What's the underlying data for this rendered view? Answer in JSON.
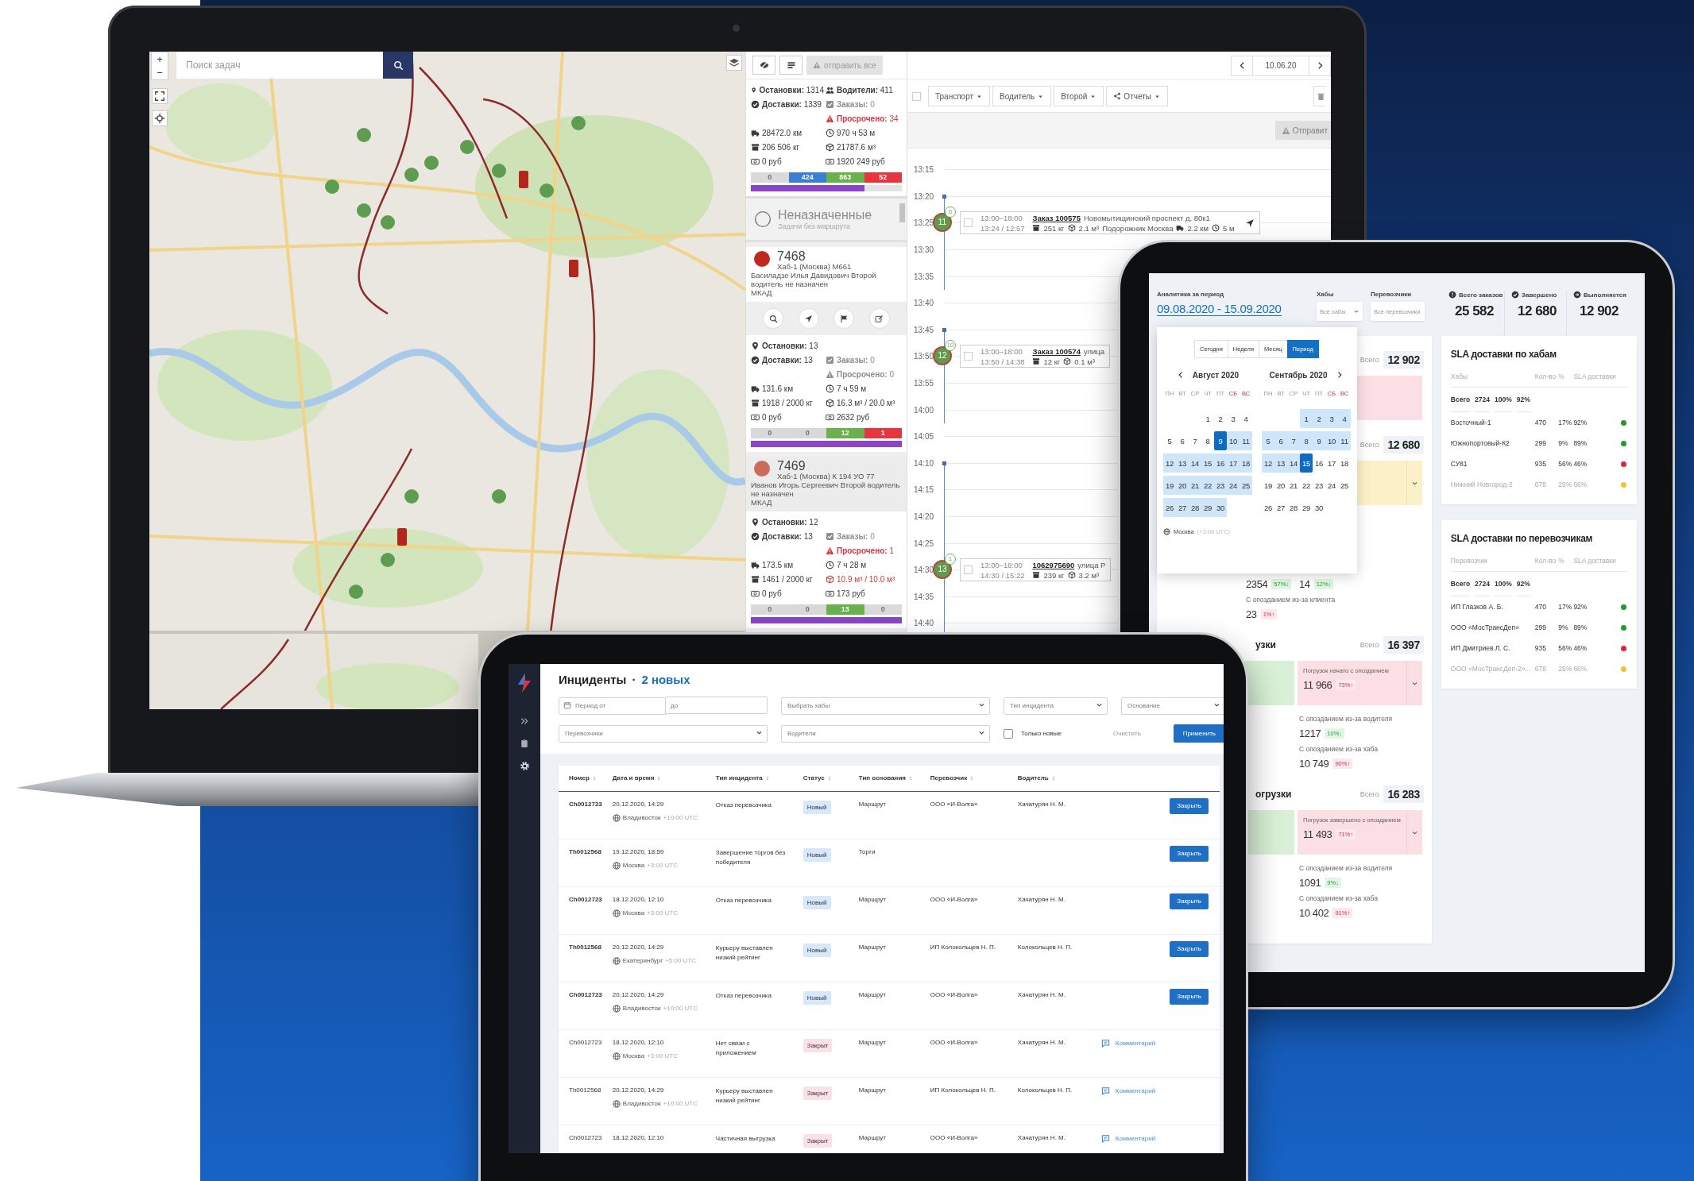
{
  "laptop": {
    "map": {
      "zoom_in": "+",
      "zoom_out": "−",
      "search": {
        "placeholder": "Поиск задач"
      }
    },
    "panel": {
      "send_all": {
        "label": "отправить все",
        "disabled": true
      },
      "summary": {
        "rows": [
          {
            "left": {
              "label": "Остановки:",
              "value": "1314"
            },
            "right": {
              "label": "Водители:",
              "value": "411"
            }
          },
          {
            "left": {
              "label": "Доставки:",
              "value": "1339"
            },
            "right": {
              "label": "Заказы:",
              "value": "0",
              "dimmed": true
            }
          },
          {
            "right": {
              "label": "Просрочено:",
              "value": "34",
              "alert": true
            }
          },
          {
            "left": {
              "value": "28472.0 км"
            },
            "right": {
              "value": "970 ч 53 м"
            }
          },
          {
            "left": {
              "value": "206 506 кг"
            },
            "right": {
              "value": "21787.6 м³"
            }
          },
          {
            "left": {
              "value": "0 руб"
            },
            "right": {
              "value": "1920 249 руб"
            }
          }
        ],
        "segments": [
          {
            "value": "0",
            "color": "#d9d9d9"
          },
          {
            "value": "424",
            "color": "#3a7fd5"
          },
          {
            "value": "863",
            "color": "#6ab04c"
          },
          {
            "value": "52",
            "color": "#e8343f"
          }
        ],
        "level": 0.75
      },
      "unassigned": {
        "title": "Неназначенные",
        "subtitle": "Задачи без маршрута"
      },
      "routes": [
        {
          "number": "7468",
          "color": "#c0281e",
          "hub": "Хаб-1 (Москва) М661",
          "driver": "Басиладзе Илья Давидович Второй водитель не назначен",
          "zone": "МКАД",
          "expanded": true,
          "rows": [
            {
              "left": {
                "label": "Остановки:",
                "value": "13"
              }
            },
            {
              "left": {
                "label": "Доставки:",
                "value": "13"
              },
              "right": {
                "label": "Заказы:",
                "value": "0",
                "dimmed": true
              }
            },
            {
              "right": {
                "label": "Просрочено:",
                "value": "0",
                "dimmed": true
              }
            },
            {
              "left": {
                "value": "131.6 км"
              },
              "right": {
                "value": "7 ч 59 м"
              }
            },
            {
              "left": {
                "value": "1918 / 2000 кг"
              },
              "right": {
                "value": "16.3 м³ / 20.0 м³"
              }
            },
            {
              "left": {
                "value": "0 руб"
              },
              "right": {
                "value": "2632 руб"
              }
            }
          ],
          "segments": [
            {
              "value": "0",
              "color": "#d9d9d9"
            },
            {
              "value": "0",
              "color": "#d8d8d8"
            },
            {
              "value": "12",
              "color": "#6ab04c"
            },
            {
              "value": "1",
              "color": "#e8343f"
            }
          ],
          "level": 1
        },
        {
          "number": "7469",
          "color": "#cc6a5c",
          "hub": "Хаб-1 (Москва) К 194 УО 77",
          "driver": "Иванов Игорь Сергеевич Второй водитель не назначен",
          "zone": "МКАД",
          "expanded": false,
          "rows": [
            {
              "left": {
                "label": "Остановки:",
                "value": "12"
              }
            },
            {
              "left": {
                "label": "Доставки:",
                "value": "13"
              },
              "right": {
                "label": "Заказы:",
                "value": "0",
                "dimmed": true
              }
            },
            {
              "right": {
                "label": "Просрочено:",
                "value": "1",
                "alert": true
              }
            },
            {
              "left": {
                "value": "173.5 км"
              },
              "right": {
                "value": "7 ч 28 м"
              }
            },
            {
              "left": {
                "value": "1461 / 2000 кг"
              },
              "right": {
                "value": "10.9 м³ / 10.0 м³",
                "alert": true
              }
            },
            {
              "left": {
                "value": "0 руб"
              },
              "right": {
                "value": "173 руб"
              }
            }
          ],
          "segments": [
            {
              "value": "0",
              "color": "#d9d9d9"
            },
            {
              "value": "0",
              "color": "#d8d8d8"
            },
            {
              "value": "13",
              "color": "#6ab04c"
            },
            {
              "value": "0",
              "color": "#dadada"
            }
          ],
          "level": 1
        }
      ]
    },
    "timeline": {
      "date": "10.06.20",
      "select_all": {
        "checked": false
      },
      "filters": [
        {
          "label": "Транспорт",
          "kind": "plain"
        },
        {
          "label": "Водитель",
          "kind": "plain"
        },
        {
          "label": "Второй",
          "kind": "plain"
        },
        {
          "label": "Отчеты",
          "kind": "share"
        }
      ],
      "send": {
        "label": "Отправит",
        "disabled": true
      },
      "groups": [
        {
          "route": false,
          "slots": [
            {
              "time": "13:15"
            }
          ]
        },
        {
          "route": true,
          "slots": [
            {
              "time": "13:20"
            },
            {
              "time": "13:25",
              "order": {
                "badge": "11",
                "count": "6",
                "checked": false,
                "window": "13:00–18:00",
                "actual": "13:24 / 12:57",
                "order": "Заказ 100575",
                "address": "Новомытищинский проспект д. 80к1",
                "weight": "251 кг",
                "volume": "2.1 м³",
                "shop": "Подорожник Москва",
                "distance": "2.2 км",
                "duration": "5 м",
                "route_button": true
              }
            },
            {
              "time": "13:30"
            },
            {
              "time": "13:35"
            }
          ]
        },
        {
          "route": false,
          "slots": [
            {
              "time": "13:40"
            }
          ]
        },
        {
          "route": true,
          "slots": [
            {
              "time": "13:45"
            },
            {
              "time": "13:50",
              "order": {
                "badge": "12",
                "count": "10",
                "checked": false,
                "window": "13:00–18:00",
                "actual": "13:50 / 14:38",
                "order": "Заказ 100574",
                "address": "улица",
                "weight": "12 кг",
                "volume": "0.1 м³"
              }
            },
            {
              "time": "13:55"
            },
            {
              "time": "14:00"
            }
          ]
        },
        {
          "route": false,
          "slots": [
            {
              "time": "14:05"
            }
          ]
        },
        {
          "route": true,
          "slots": [
            {
              "time": "14:10"
            },
            {
              "time": "14:15"
            },
            {
              "time": "14:20"
            },
            {
              "time": "14:25"
            },
            {
              "time": "14:30",
              "order": {
                "badge": "13",
                "count": "1",
                "checked": false,
                "window": "13:00–18:00",
                "actual": "14:30 / 15:22",
                "order": "1062975690",
                "address": "улица Р",
                "weight": "239 кг",
                "volume": "3.2 м³"
              }
            },
            {
              "time": "14:35"
            },
            {
              "time": "14:40"
            }
          ]
        }
      ]
    }
  },
  "analytics": {
    "period": {
      "label": "Аналитика за период",
      "value": "09.08.2020 - 15.09.2020"
    },
    "filters": [
      {
        "label": "Хабы",
        "placeholder": "Все хабы"
      },
      {
        "label": "Перевозчики",
        "placeholder": "Все перевозчики"
      }
    ],
    "kpis": [
      {
        "label": "Всего заказов",
        "value": "25 582"
      },
      {
        "label": "Завершено",
        "value": "12 680"
      },
      {
        "label": "Выполняется",
        "value": "12 902"
      }
    ],
    "calendar": {
      "ranges": [
        {
          "label": "Сегодня",
          "selected": false
        },
        {
          "label": "Неделя",
          "selected": false
        },
        {
          "label": "Месяц",
          "selected": false
        },
        {
          "label": "Период",
          "selected": true
        }
      ],
      "months": [
        {
          "title": "Август  2020",
          "weekdays": [
            {
              "label": "ПН",
              "weekend": false
            },
            {
              "label": "ВТ",
              "weekend": false
            },
            {
              "label": "СР",
              "weekend": false
            },
            {
              "label": "ЧТ",
              "weekend": false
            },
            {
              "label": "ПТ",
              "weekend": false
            },
            {
              "label": "СБ",
              "weekend": true
            },
            {
              "label": "ВС",
              "weekend": true
            }
          ],
          "weeks": [
            {
              "right_aligned": true,
              "days": [
                {
                  "label": "1",
                  "selected": false,
                  "in_range": false
                },
                {
                  "label": "2",
                  "selected": false,
                  "in_range": false
                },
                {
                  "label": "3",
                  "selected": false,
                  "in_range": false
                },
                {
                  "label": "4",
                  "selected": false,
                  "in_range": false
                }
              ]
            },
            {
              "days": [
                {
                  "label": "5",
                  "selected": false,
                  "in_range": false
                },
                {
                  "label": "6",
                  "selected": false,
                  "in_range": false
                },
                {
                  "label": "7",
                  "selected": false,
                  "in_range": false
                },
                {
                  "label": "8",
                  "selected": false,
                  "in_range": false
                },
                {
                  "label": "9",
                  "selected": true,
                  "in_range": true
                },
                {
                  "label": "10",
                  "selected": false,
                  "in_range": true
                },
                {
                  "label": "11",
                  "selected": false,
                  "in_range": true
                }
              ]
            },
            {
              "days": [
                {
                  "label": "12",
                  "selected": false,
                  "in_range": true
                },
                {
                  "label": "13",
                  "selected": false,
                  "in_range": true
                },
                {
                  "label": "14",
                  "selected": false,
                  "in_range": true
                },
                {
                  "label": "15",
                  "selected": false,
                  "in_range": true
                },
                {
                  "label": "16",
                  "selected": false,
                  "in_range": true
                },
                {
                  "label": "17",
                  "selected": false,
                  "in_range": true
                },
                {
                  "label": "18",
                  "selected": false,
                  "in_range": true
                }
              ]
            },
            {
              "days": [
                {
                  "label": "19",
                  "selected": false,
                  "in_range": true
                },
                {
                  "label": "20",
                  "selected": false,
                  "in_range": true
                },
                {
                  "label": "21",
                  "selected": false,
                  "in_range": true
                },
                {
                  "label": "22",
                  "selected": false,
                  "in_range": true
                },
                {
                  "label": "23",
                  "selected": false,
                  "in_range": true
                },
                {
                  "label": "24",
                  "selected": false,
                  "in_range": true
                },
                {
                  "label": "25",
                  "selected": false,
                  "in_range": true
                }
              ]
            },
            {
              "days": [
                {
                  "label": "26",
                  "selected": false,
                  "in_range": true
                },
                {
                  "label": "27",
                  "selected": false,
                  "in_range": true
                },
                {
                  "label": "28",
                  "selected": false,
                  "in_range": true
                },
                {
                  "label": "29",
                  "selected": false,
                  "in_range": true
                },
                {
                  "label": "30",
                  "selected": false,
                  "in_range": true
                }
              ]
            }
          ]
        },
        {
          "title": "Сентябрь  2020",
          "weekdays": [
            {
              "label": "ПН",
              "weekend": false
            },
            {
              "label": "ВТ",
              "weekend": false
            },
            {
              "label": "СР",
              "weekend": false
            },
            {
              "label": "ЧТ",
              "weekend": false
            },
            {
              "label": "ПТ",
              "weekend": false
            },
            {
              "label": "СБ",
              "weekend": true
            },
            {
              "label": "ВС",
              "weekend": true
            }
          ],
          "weeks": [
            {
              "right_aligned": true,
              "days": [
                {
                  "label": "1",
                  "selected": false,
                  "in_range": true
                },
                {
                  "label": "2",
                  "selected": false,
                  "in_range": true
                },
                {
                  "label": "3",
                  "selected": false,
                  "in_range": true
                },
                {
                  "label": "4",
                  "selected": false,
                  "in_range": true
                }
              ]
            },
            {
              "days": [
                {
                  "label": "5",
                  "selected": false,
                  "in_range": true
                },
                {
                  "label": "6",
                  "selected": false,
                  "in_range": true
                },
                {
                  "label": "7",
                  "selected": false,
                  "in_range": true
                },
                {
                  "label": "8",
                  "selected": false,
                  "in_range": true
                },
                {
                  "label": "9",
                  "selected": false,
                  "in_range": true
                },
                {
                  "label": "10",
                  "selected": false,
                  "in_range": true
                },
                {
                  "label": "11",
                  "selected": false,
                  "in_range": true
                }
              ]
            },
            {
              "days": [
                {
                  "label": "12",
                  "selected": false,
                  "in_range": true
                },
                {
                  "label": "13",
                  "selected": false,
                  "in_range": true
                },
                {
                  "label": "14",
                  "selected": false,
                  "in_range": true
                },
                {
                  "label": "15",
                  "selected": true,
                  "in_range": true
                },
                {
                  "label": "16",
                  "selected": false,
                  "in_range": false
                },
                {
                  "label": "17",
                  "selected": false,
                  "in_range": false
                },
                {
                  "label": "18",
                  "selected": false,
                  "in_range": false
                }
              ]
            },
            {
              "days": [
                {
                  "label": "19",
                  "selected": false,
                  "in_range": false
                },
                {
                  "label": "20",
                  "selected": false,
                  "in_range": false
                },
                {
                  "label": "21",
                  "selected": false,
                  "in_range": false
                },
                {
                  "label": "22",
                  "selected": false,
                  "in_range": false
                },
                {
                  "label": "23",
                  "selected": false,
                  "in_range": false
                },
                {
                  "label": "24",
                  "selected": false,
                  "in_range": false
                },
                {
                  "label": "25",
                  "selected": false,
                  "in_range": false
                }
              ]
            },
            {
              "days": [
                {
                  "label": "26",
                  "selected": false,
                  "in_range": false
                },
                {
                  "label": "27",
                  "selected": false,
                  "in_range": false
                },
                {
                  "label": "28",
                  "selected": false,
                  "in_range": false
                },
                {
                  "label": "29",
                  "selected": false,
                  "in_range": false
                },
                {
                  "label": "30",
                  "selected": false,
                  "in_range": false
                }
              ]
            }
          ]
        }
      ],
      "timezone": {
        "city": "Москва",
        "offset": "(+3:00 UTC)"
      }
    },
    "sections": [
      {
        "total_label": "Всего",
        "total": "12 902",
        "late": {
          "color": "#fbdfe4"
        }
      },
      {
        "total_label": "Всего",
        "total": "12 680",
        "late": {
          "color": "#fbf0c8",
          "chevron": true
        },
        "metrics_left": [
          {
            "value": "2354",
            "delta": "57%↓",
            "rising": false
          },
          {
            "label": "С опозданием из-за клиента",
            "value": "23",
            "delta": "1%↑",
            "rising": true
          }
        ],
        "metrics_right": [
          {
            "value": "14",
            "delta": "12%↓",
            "rising": false
          }
        ]
      },
      {
        "title": "узки",
        "total_label": "Всего",
        "total": "16 397",
        "late": {
          "color": "#fbdfe4",
          "chevron": true,
          "label": "Погрузок начато с опозданием",
          "value": "11 966",
          "delta": "73%↑",
          "rising": true
        },
        "metrics_right": [
          {
            "label": "С опозданием из-за водителя",
            "value": "1217",
            "delta": "10%↓",
            "rising": false
          },
          {
            "label": "С опозданием из-за хаба",
            "value": "10 749",
            "delta": "90%↑",
            "rising": true
          }
        ]
      },
      {
        "title": "огрузки",
        "total_label": "Всего",
        "total": "16 283",
        "late": {
          "color": "#fbdfe4",
          "chevron": true,
          "label": "Погрузок завершено с опозданием",
          "value": "11 493",
          "delta": "71%↑",
          "rising": true
        },
        "metrics_right": [
          {
            "label": "С опозданием из-за водителя",
            "value": "1091",
            "delta": "9%↓",
            "rising": false
          },
          {
            "label": "С опозданием из-за хаба",
            "value": "10 402",
            "delta": "91%↑",
            "rising": true
          }
        ]
      }
    ],
    "tables": [
      {
        "title": "SLA доставки по хабам",
        "columns": [
          "Хабы",
          "Кол-во",
          "%",
          "SLA доставки"
        ],
        "total": [
          "Всего",
          "2724",
          "100%",
          "92%"
        ],
        "rows": [
          {
            "cells": [
              "Восточный-1",
              "470",
              "17%",
              "92%"
            ],
            "color": "#1f9d2b",
            "faded": false
          },
          {
            "cells": [
              "Южнопортовый-К2",
              "299",
              "9%",
              "89%"
            ],
            "color": "#1f9d2b",
            "faded": false
          },
          {
            "cells": [
              "СУ81",
              "935",
              "56%",
              "46%"
            ],
            "color": "#e0263a",
            "faded": false
          },
          {
            "cells": [
              "Нижний Новгород-2",
              "678",
              "25%",
              "66%"
            ],
            "color": "#f2c230",
            "faded": true
          }
        ]
      },
      {
        "title": "SLA доставки по перевозчикам",
        "columns": [
          "Перевозчик",
          "Кол-во",
          "%",
          "SLA доставки"
        ],
        "total": [
          "Всего",
          "2724",
          "100%",
          "92%"
        ],
        "rows": [
          {
            "cells": [
              "ИП Глазков А. Б.",
              "470",
              "17%",
              "92%"
            ],
            "color": "#1f9d2b",
            "faded": false
          },
          {
            "cells": [
              "ООО «МосТрансДеп»",
              "299",
              "9%",
              "89%"
            ],
            "color": "#1f9d2b",
            "faded": false
          },
          {
            "cells": [
              "ИП Дмитриев Л. С.",
              "935",
              "56%",
              "46%"
            ],
            "color": "#e0263a",
            "faded": false
          },
          {
            "cells": [
              "ООО «МосТрансДеп-2»...",
              "678",
              "25%",
              "66%"
            ],
            "color": "#f2c230",
            "faded": true
          }
        ]
      }
    ]
  },
  "incidents": {
    "title": "Инциденты",
    "separator": "·",
    "new_count": "2 новых",
    "filters": {
      "period_from": {
        "placeholder": "Период от"
      },
      "period_to": {
        "placeholder": "до"
      },
      "selects": [
        {
          "placeholder": "Выбрать хабы"
        },
        {
          "placeholder": "Тип инцидента"
        },
        {
          "placeholder": "Основание"
        },
        {
          "placeholder": "Перевозчики"
        },
        {
          "placeholder": "Водители"
        }
      ],
      "only_new": {
        "label": "Только новые",
        "checked": false
      },
      "clear": "Очистить",
      "apply": "Применить"
    },
    "columns": [
      "Номер",
      "Дата и время",
      "Тип инцидента",
      "Статус",
      "Тип основания",
      "Перевозчик",
      "Водитель"
    ],
    "rows": [
      {
        "number": "Ch0012723",
        "date": "20.12.2020, 14:29",
        "city": "Владивосток",
        "offset": "+10:00 UTC",
        "type": "Отказ перевозчика",
        "status": {
          "label": "Новый",
          "kind": "new"
        },
        "basis": "Маршрут",
        "carrier": "ООО «И-Волга»",
        "driver": "Хачатурян Н. М.",
        "action": {
          "kind": "close",
          "label": "Закрыть"
        }
      },
      {
        "number": "Th0012568",
        "date": "19.12.2020, 18:59",
        "city": "Москва",
        "offset": "+3:00 UTC",
        "type": "Завершение торгов без победителя",
        "status": {
          "label": "Новый",
          "kind": "new"
        },
        "basis": "Торги",
        "action": {
          "kind": "close",
          "label": "Закрыть"
        }
      },
      {
        "number": "Ch0012723",
        "date": "18.12.2020, 12:10",
        "city": "Москва",
        "offset": "+3:00 UTC",
        "type": "Отказ перевозчика",
        "status": {
          "label": "Новый",
          "kind": "new"
        },
        "basis": "Маршрут",
        "carrier": "ООО «И-Волга»",
        "driver": "Хачатурян Н. М.",
        "action": {
          "kind": "close",
          "label": "Закрыть"
        }
      },
      {
        "number": "Th0012568",
        "date": "20.12.2020, 14:29",
        "city": "Екатеринбург",
        "offset": "+5:00 UTC",
        "type": "Курьеру выставлен низкий рейтинг",
        "status": {
          "label": "Новый",
          "kind": "new"
        },
        "basis": "Маршрут",
        "carrier": "ИП Колокольцев Н. П.",
        "driver": "Колокольцев Н. П.",
        "action": {
          "kind": "close",
          "label": "Закрыть"
        }
      },
      {
        "number": "Ch0012723",
        "date": "20.12.2020, 14:29",
        "city": "Владивосток",
        "offset": "+10:00 UTC",
        "type": "Отказ перевозчика",
        "status": {
          "label": "Новый",
          "kind": "new"
        },
        "basis": "Маршрут",
        "carrier": "ООО «И-Волга»",
        "driver": "Хачатурян Н. М.",
        "action": {
          "kind": "close",
          "label": "Закрыть"
        }
      },
      {
        "number": "Ch0012723",
        "date": "18.12.2020, 12:10",
        "city": "Москва",
        "offset": "+3:00 UTC",
        "type": "Нет связи с приложением",
        "status": {
          "label": "Закрыт",
          "kind": "closed"
        },
        "basis": "Маршрут",
        "carrier": "ООО «И-Волга»",
        "driver": "Хачатурян Н. М.",
        "action": {
          "kind": "comment",
          "label": "Комментарий"
        }
      },
      {
        "number": "Th0012568",
        "date": "20.12.2020, 14:29",
        "city": "Владивосток",
        "offset": "+10:00 UTC",
        "type": "Курьеру выставлен низкий рейтинг",
        "status": {
          "label": "Закрыт",
          "kind": "closed"
        },
        "basis": "Маршрут",
        "carrier": "ИП Колокольцев Н. П.",
        "driver": "Колокольцев Н. П.",
        "action": {
          "kind": "comment",
          "label": "Комментарий"
        }
      },
      {
        "number": "Ch0012723",
        "date": "18.12.2020, 12:10",
        "type": "Частичная выгрузка",
        "status": {
          "label": "Закрыт",
          "kind": "closed"
        },
        "basis": "Маршрут",
        "carrier": "ООО «И-Волга»",
        "driver": "Хачатурян Н. М.",
        "action": {
          "kind": "comment",
          "label": "Комментарий"
        }
      }
    ]
  }
}
